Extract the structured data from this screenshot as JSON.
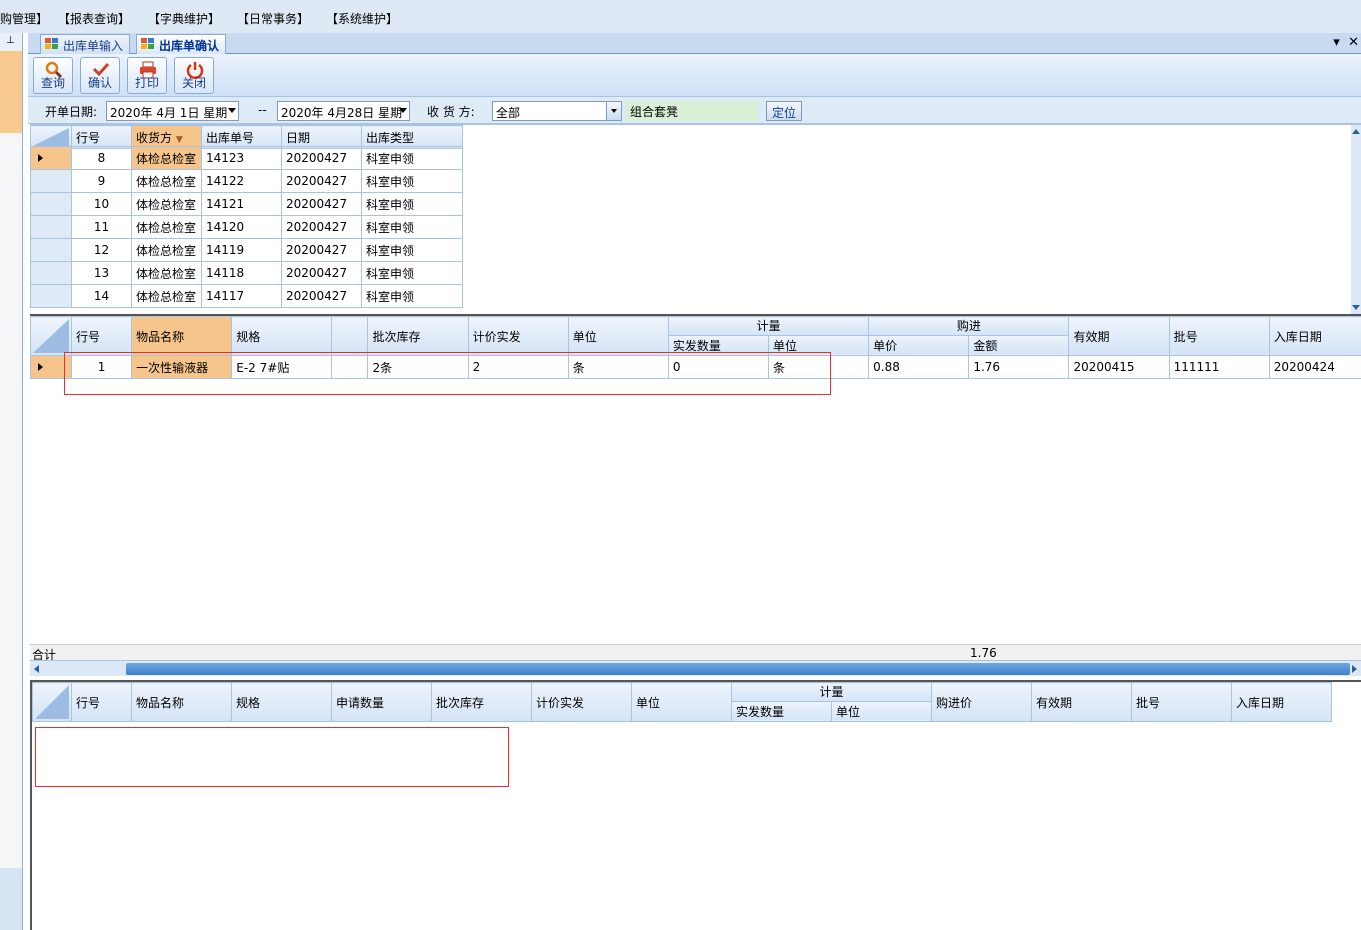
{
  "menu": [
    "购管理】",
    "【报表查询】",
    "【字典维护】",
    "【日常事务】",
    "【系统维护】"
  ],
  "tabs": [
    "出库单输入",
    "出库单确认"
  ],
  "toolbar": {
    "query": "查询",
    "confirm": "确认",
    "print": "打印",
    "close": "关闭"
  },
  "filter": {
    "date_label": "开单日期:",
    "date_from": "2020年 4月 1日 星期",
    "range_sep": "--",
    "date_to": "2020年 4月28日 星期",
    "receiver_label": "收 货 方:",
    "receiver_value": "全部",
    "set_value": "组合套凳",
    "locate_button": "定位"
  },
  "grid1": {
    "headers": [
      "行号",
      "收货方",
      "出库单号",
      "日期",
      "出库类型"
    ],
    "rows": [
      [
        "8",
        "体检总检室",
        "14123",
        "20200427",
        "科室申领"
      ],
      [
        "9",
        "体检总检室",
        "14122",
        "20200427",
        "科室申领"
      ],
      [
        "10",
        "体检总检室",
        "14121",
        "20200427",
        "科室申领"
      ],
      [
        "11",
        "体检总检室",
        "14120",
        "20200427",
        "科室申领"
      ],
      [
        "12",
        "体检总检室",
        "14119",
        "20200427",
        "科室申领"
      ],
      [
        "13",
        "体检总检室",
        "14118",
        "20200427",
        "科室申领"
      ],
      [
        "14",
        "体检总检室",
        "14117",
        "20200427",
        "科室申领"
      ]
    ]
  },
  "grid2": {
    "headers": [
      "行号",
      "物品名称",
      "规格",
      "",
      "批次库存",
      "计价实发",
      "单位",
      "计量",
      "实发数量",
      "单位",
      "购进",
      "单价",
      "金额",
      "有效期",
      "批号",
      "入库日期"
    ],
    "row": [
      "1",
      "一次性输液器",
      "E-2 7#贴",
      "",
      "2条",
      "2",
      "条",
      "0",
      "条",
      "0.88",
      "1.76",
      "20200415",
      "111111",
      "20200424"
    ],
    "sum_label": "合计",
    "sum_value": "1.76"
  },
  "grid3": {
    "headers": [
      "行号",
      "物品名称",
      "规格",
      "申请数量",
      "批次库存",
      "计价实发",
      "单位",
      "计量",
      "实发数量",
      "单位",
      "购进价",
      "有效期",
      "批号",
      "入库日期"
    ]
  },
  "colors": {
    "accent": "#f6c58c",
    "header": "#d4e3f6",
    "highlight_box": "#e03030"
  }
}
